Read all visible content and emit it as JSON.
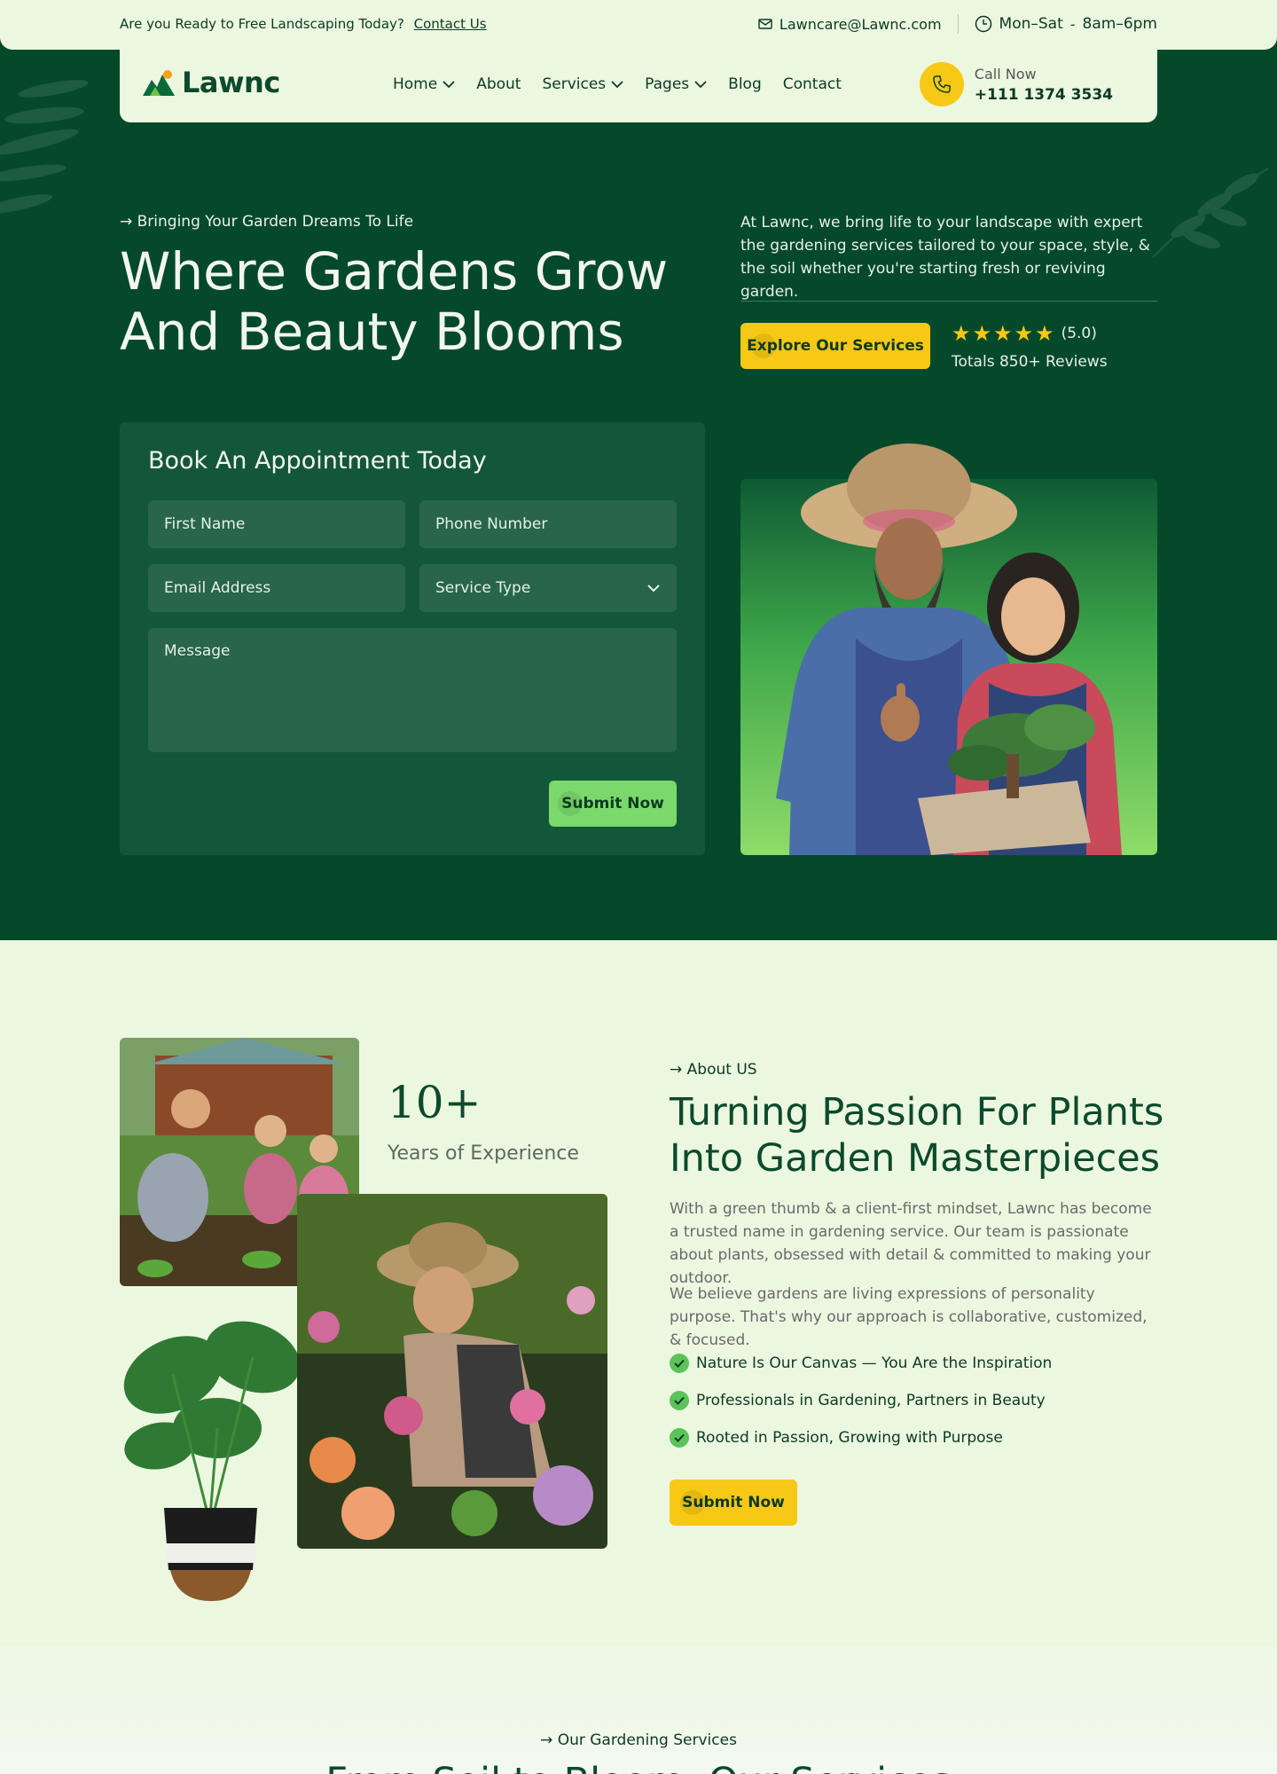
{
  "topbar": {
    "prompt": "Are you Ready to Free Landscaping Today?",
    "contact_link": "Contact Us",
    "email": "Lawncare@Lawnc.com",
    "hours_days": "Mon–Sat",
    "hours_sep": "-",
    "hours_time": "8am–6pm"
  },
  "nav": {
    "brand": "Lawnc",
    "items": [
      {
        "label": "Home",
        "dropdown": true
      },
      {
        "label": "About",
        "dropdown": false
      },
      {
        "label": "Services",
        "dropdown": true
      },
      {
        "label": "Pages",
        "dropdown": true
      },
      {
        "label": "Blog",
        "dropdown": false
      },
      {
        "label": "Contact",
        "dropdown": false
      }
    ],
    "call_label": "Call Now",
    "call_number": "+111 1374 3534"
  },
  "hero": {
    "eyebrow": "→ Bringing Your Garden Dreams To Life",
    "title": "Where Gardens Grow And Beauty Blooms",
    "description": "At Lawnc, we bring life to your landscape with expert the gardening services tailored to your space, style, & the soil whether you're starting fresh or reviving garden.",
    "cta": "Explore Our Services",
    "rating_value": "(5.0)",
    "stars": 5,
    "reviews_total": "Totals 850+ Reviews"
  },
  "form": {
    "title": "Book An Appointment Today",
    "first_name_placeholder": "First Name",
    "phone_placeholder": "Phone Number",
    "email_placeholder": "Email Address",
    "service_type_value": "Service Type",
    "message_placeholder": "Message",
    "submit": "Submit Now"
  },
  "about": {
    "experience_number": "10+",
    "experience_label": "Years of Experience",
    "eyebrow": "→ About US",
    "title": "Turning Passion For Plants Into Garden Masterpieces",
    "paragraph_1": "With a green thumb & a client-first mindset, Lawnc has become a trusted name in gardening service. Our team is passionate about plants, obsessed with detail & committed to making your outdoor.",
    "paragraph_2": "We believe gardens are living expressions of personality purpose. That's why our approach is collaborative, customized, & focused.",
    "checklist": [
      "Nature Is Our Canvas — You Are the Inspiration",
      "Professionals in Gardening, Partners in Beauty",
      "Rooted in Passion, Growing with Purpose"
    ],
    "cta": "Submit Now"
  },
  "services": {
    "eyebrow": "→ Our Gardening Services",
    "title": "From Soil to Bloom, Our Services"
  },
  "colors": {
    "dark_green": "#05492b",
    "card_green": "#13573a",
    "field_green": "#28654a",
    "light_bg": "#ecf7e0",
    "yellow": "#f7c815",
    "lime": "#7bd86a"
  }
}
